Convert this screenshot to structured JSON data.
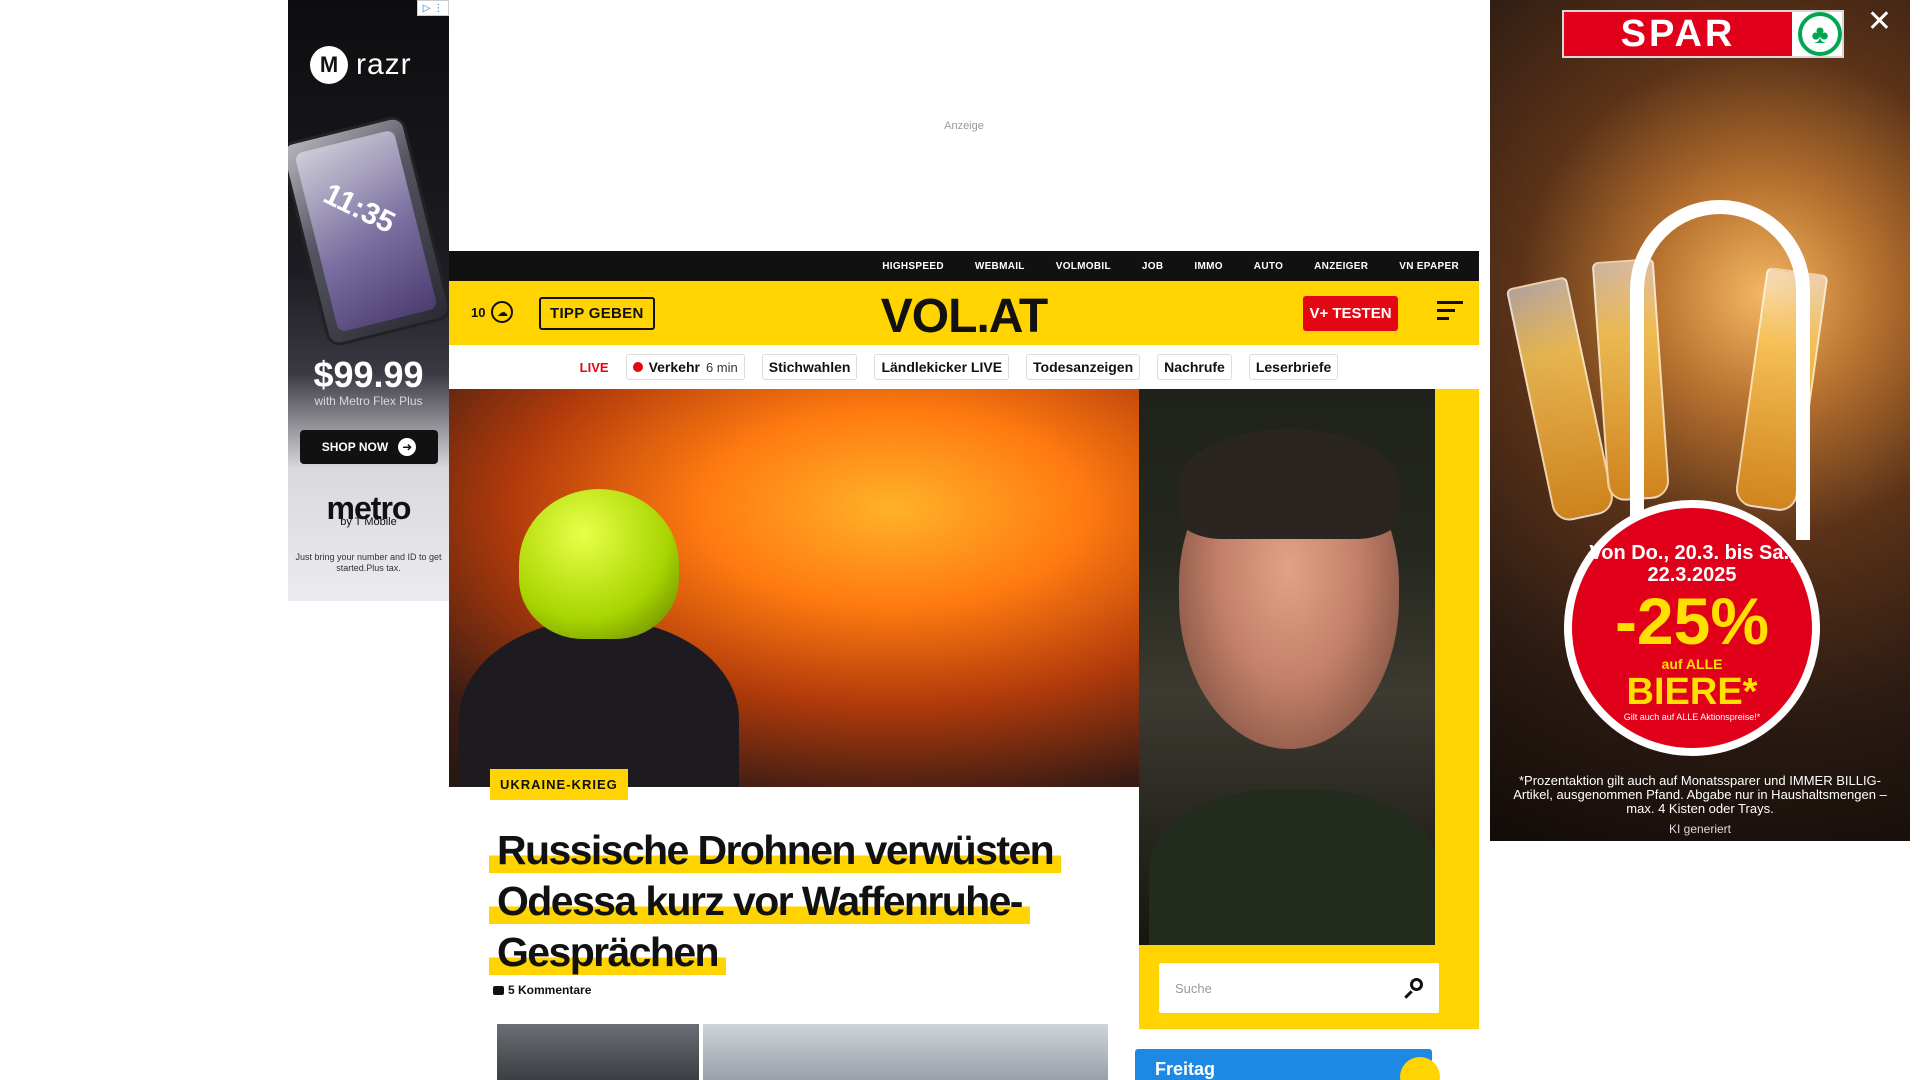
{
  "ad_left": {
    "adchoices": "▷ ⋮",
    "brand_letter": "M",
    "brand": "razr",
    "phone_time": "11:35",
    "price": "$99.99",
    "price_sub": "with Metro Flex Plus",
    "cta": "SHOP NOW",
    "metro": "metro",
    "tmobile": "by T Mobile",
    "disclaimer": "Just bring your number and ID to get started.Plus tax."
  },
  "ad_top": {
    "label": "Anzeige"
  },
  "ad_right": {
    "logo_text": "SPAR",
    "close": "✕",
    "dates": "Von Do., 20.3. bis Sa., 22.3.2025",
    "discount": "-25%",
    "auf_alle": "auf ALLE",
    "product": "BIERE*",
    "gilt": "Gilt auch auf ALLE Aktionspreise!*",
    "fine_print": "*Prozentaktion gilt auch auf Monatssparer und IMMER BILLIG-Artikel, ausgenommen Pfand. Abgabe nur in Haushaltsmengen – max. 4 Kisten oder Trays.",
    "ki": "KI generiert"
  },
  "topbar": {
    "links": [
      "HIGHSPEED",
      "WEBMAIL",
      "VOLMOBIL",
      "JOB",
      "IMMO",
      "AUTO",
      "ANZEIGER",
      "VN EPAPER"
    ]
  },
  "header": {
    "temperature": "10",
    "tipp": "TIPP GEBEN",
    "logo": "VOL.AT",
    "vplus": "V+ TESTEN"
  },
  "quicknav": {
    "live": "LIVE",
    "verkehr": "Verkehr",
    "verkehr_time": "6 min",
    "items": [
      "Stichwahlen",
      "Ländlekicker LIVE",
      "Todesanzeigen",
      "Nachrufe",
      "Leserbriefe"
    ]
  },
  "hero": {
    "tag": "UKRAINE-KRIEG",
    "title": "Russische Drohnen verwüsten Odessa kurz vor Waffenruhe-Gesprächen",
    "comments": "5 Kommentare",
    "search_placeholder": "Suche"
  },
  "weather": {
    "day": "Freitag"
  }
}
